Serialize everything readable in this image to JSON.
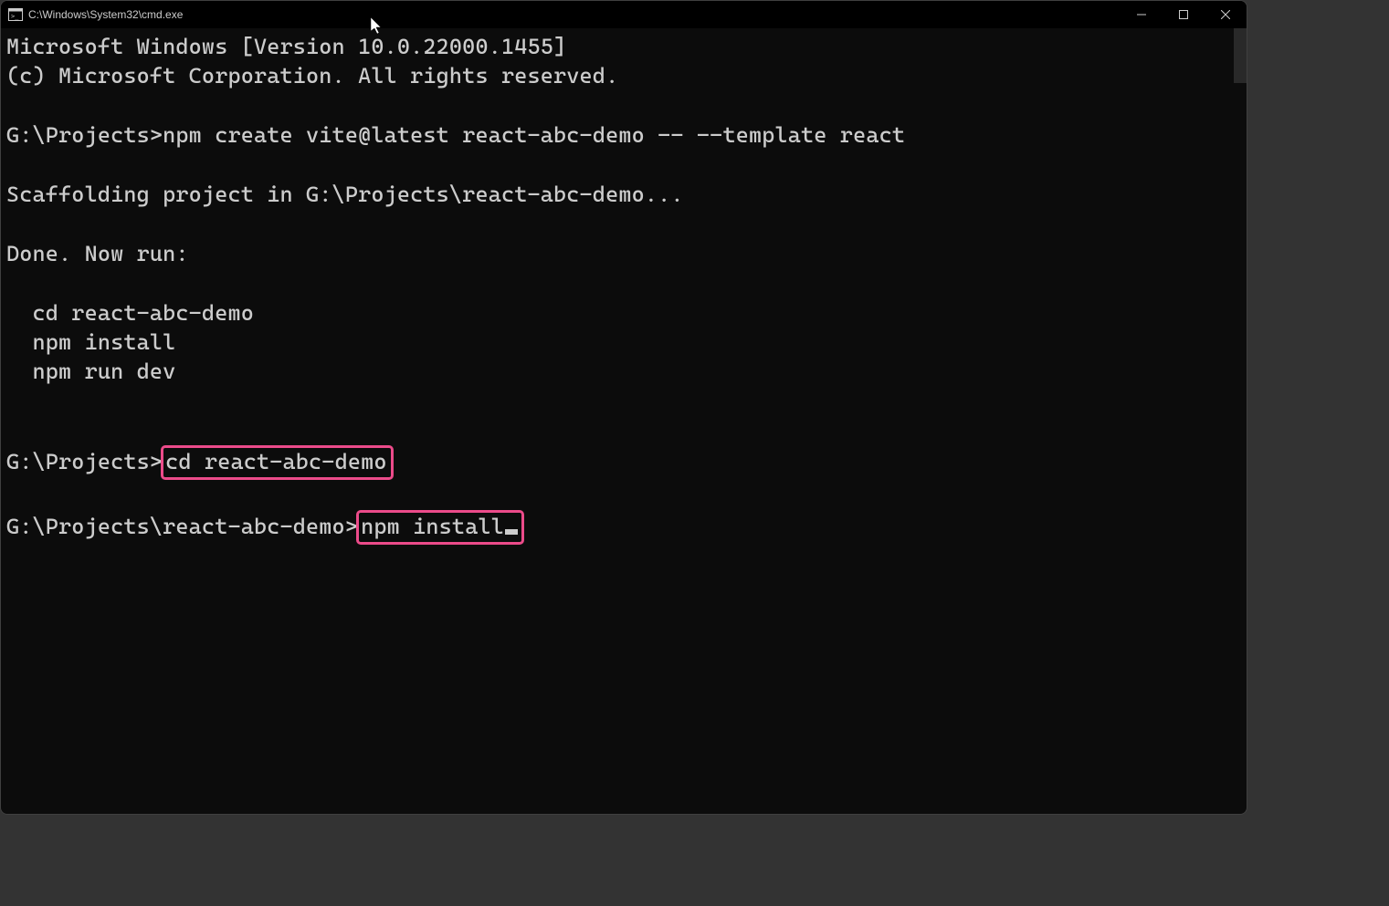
{
  "titlebar": {
    "title": "C:\\Windows\\System32\\cmd.exe"
  },
  "terminal": {
    "line1": "Microsoft Windows [Version 10.0.22000.1455]",
    "line2": "(c) Microsoft Corporation. All rights reserved.",
    "prompt1_path": "G:\\Projects>",
    "prompt1_cmd": "npm create vite@latest react-abc-demo -- --template react",
    "output1": "Scaffolding project in G:\\Projects\\react-abc-demo...",
    "output2": "Done. Now run:",
    "output3": "  cd react-abc-demo",
    "output4": "  npm install",
    "output5": "  npm run dev",
    "prompt2_path": "G:\\Projects>",
    "prompt2_cmd": "cd react-abc-demo",
    "prompt3_path": "G:\\Projects\\react-abc-demo>",
    "prompt3_cmd": "npm install"
  },
  "highlight_color": "#ec4b8a"
}
